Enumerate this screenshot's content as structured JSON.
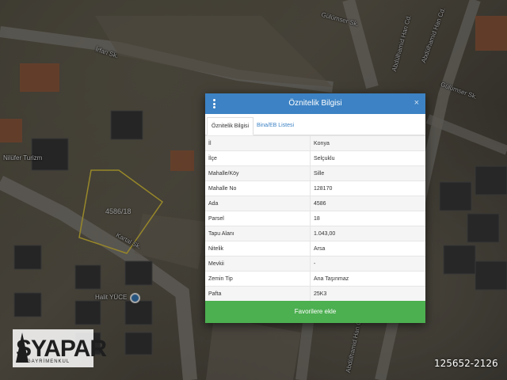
{
  "map": {
    "streets": [
      "İrfan Sk.",
      "Gülümser Sk.",
      "Abdülhamid Han Cd.",
      "Gülümser Sk.",
      "Abdülhamid Han Cd.",
      "Abdülhamid Han Cd.",
      "Kartal Sk."
    ],
    "parcel_label": "4586/18",
    "poi": [
      "Nilüfer Turizm",
      "Halit YÜCE"
    ]
  },
  "logo": {
    "brand": "SYAPAR",
    "tagline": "GAYRİMENKUL"
  },
  "listing_id": "125652-2126",
  "modal": {
    "title": "Öznitelik Bilgisi",
    "close": "×",
    "tabs": [
      "Öznitelik Bilgisi",
      "Bina/EB Listesi"
    ],
    "rows": [
      {
        "key": "İl",
        "value": "Konya"
      },
      {
        "key": "İlçe",
        "value": "Selçuklu"
      },
      {
        "key": "Mahalle/Köy",
        "value": "Sille"
      },
      {
        "key": "Mahalle No",
        "value": "128170"
      },
      {
        "key": "Ada",
        "value": "4586"
      },
      {
        "key": "Parsel",
        "value": "18"
      },
      {
        "key": "Tapu Alanı",
        "value": "1.043,00"
      },
      {
        "key": "Nitelik",
        "value": "Arsa"
      },
      {
        "key": "Mevkii",
        "value": "-"
      },
      {
        "key": "Zemin Tip",
        "value": "Ana Taşınmaz"
      },
      {
        "key": "Pafta",
        "value": "25K3"
      }
    ],
    "favorite_button": "Favorilere ekle"
  },
  "colors": {
    "header": "#3c82c4",
    "button": "#4caf50",
    "parcel_outline": "#e8d040"
  }
}
